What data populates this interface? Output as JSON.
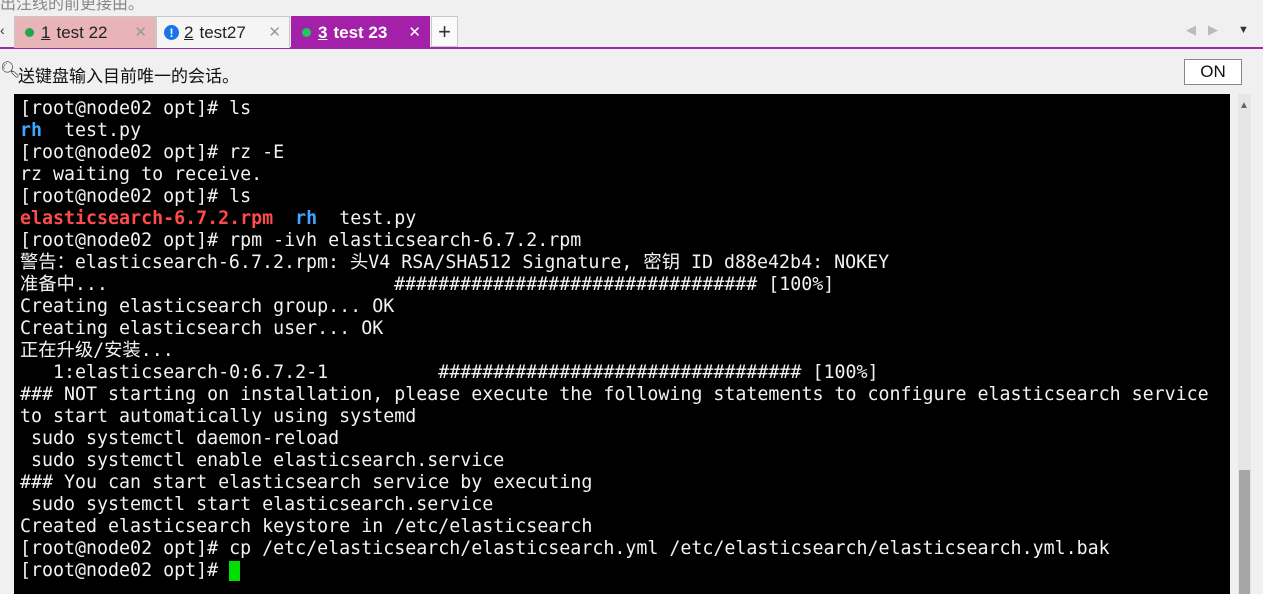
{
  "top_strip_text": "出注线的前更接由。",
  "tabs": [
    {
      "number": "1",
      "label": "test 22",
      "status_color": "#1fa84a"
    },
    {
      "number": "2",
      "label": "test27",
      "status": "info"
    },
    {
      "number": "3",
      "label": "test 23",
      "status_color": "#22c55e",
      "active": true
    }
  ],
  "tab_close_glyph": "✕",
  "tab_add_glyph": "+",
  "info_icon_glyph": "!",
  "infobar": {
    "message": "送键盘输入目前唯一的会话。",
    "on_button_label": "ON"
  },
  "colors": {
    "active_tab": "#a321a8",
    "terminal_bg": "#000000",
    "cursor": "#00e000",
    "dir_color": "#3fa7ff",
    "archive_color": "#ff4b4b"
  },
  "terminal": {
    "lines": [
      [
        {
          "t": "[root@node02 opt]# ls"
        }
      ],
      [
        {
          "t": "rh",
          "c": "blue"
        },
        {
          "t": "  test.py"
        }
      ],
      [
        {
          "t": "[root@node02 opt]# rz -E"
        }
      ],
      [
        {
          "t": "rz waiting to receive."
        }
      ],
      [
        {
          "t": "[root@node02 opt]# ls"
        }
      ],
      [
        {
          "t": "elasticsearch-6.7.2.rpm",
          "c": "red"
        },
        {
          "t": "  "
        },
        {
          "t": "rh",
          "c": "blue"
        },
        {
          "t": "  test.py"
        }
      ],
      [
        {
          "t": "[root@node02 opt]# rpm -ivh elasticsearch-6.7.2.rpm"
        }
      ],
      [
        {
          "t": "警告：elasticsearch-6.7.2.rpm: 头V4 RSA/SHA512 Signature, 密钥 ID d88e42b4: NOKEY"
        }
      ],
      [
        {
          "t": "准备中...                          ################################# [100%]"
        }
      ],
      [
        {
          "t": "Creating elasticsearch group... OK"
        }
      ],
      [
        {
          "t": "Creating elasticsearch user... OK"
        }
      ],
      [
        {
          "t": "正在升级/安装..."
        }
      ],
      [
        {
          "t": "   1:elasticsearch-0:6.7.2-1          ################################# [100%]"
        }
      ],
      [
        {
          "t": "### NOT starting on installation, please execute the following statements to configure elasticsearch service"
        }
      ],
      [
        {
          "t": "to start automatically using systemd"
        }
      ],
      [
        {
          "t": " sudo systemctl daemon-reload"
        }
      ],
      [
        {
          "t": " sudo systemctl enable elasticsearch.service"
        }
      ],
      [
        {
          "t": "### You can start elasticsearch service by executing"
        }
      ],
      [
        {
          "t": " sudo systemctl start elasticsearch.service"
        }
      ],
      [
        {
          "t": "Created elasticsearch keystore in /etc/elasticsearch"
        }
      ],
      [
        {
          "t": "[root@node02 opt]# cp /etc/elasticsearch/elasticsearch.yml /etc/elasticsearch/elasticsearch.yml.bak"
        }
      ],
      [
        {
          "t": "[root@node02 opt]# "
        },
        {
          "cursor": true
        }
      ]
    ]
  }
}
